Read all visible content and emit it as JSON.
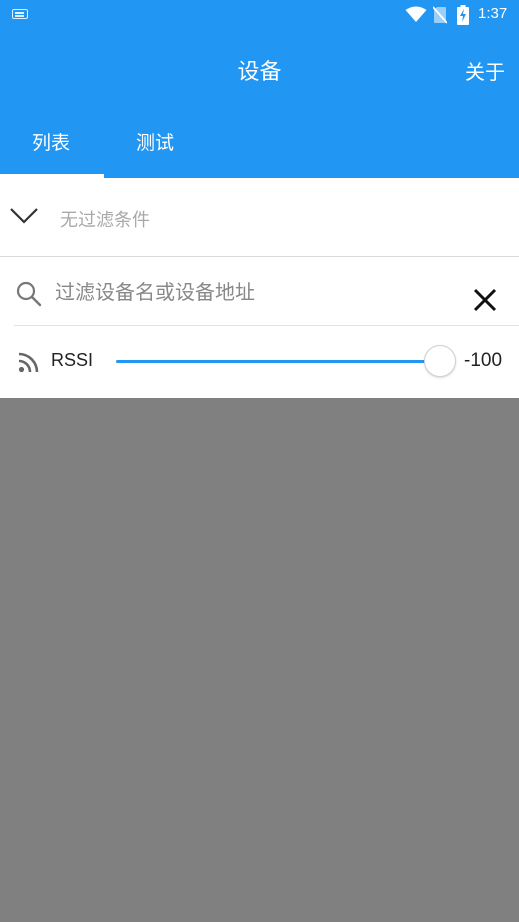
{
  "status_bar": {
    "time": "1:37"
  },
  "app_bar": {
    "title": "设备",
    "about_label": "关于"
  },
  "tabs": [
    {
      "label": "列表",
      "selected": true
    },
    {
      "label": "测试",
      "selected": false
    }
  ],
  "filter": {
    "summary_label": "无过滤条件",
    "search": {
      "placeholder": "过滤设备名或设备地址",
      "value": ""
    },
    "rssi": {
      "label": "RSSI",
      "value": "-100",
      "slider_fraction": 1.0
    }
  },
  "colors": {
    "primary": "#2196F3",
    "background": "#808080",
    "panel": "#FFFFFF"
  },
  "icons": [
    "keyboard-icon",
    "wifi-icon",
    "no-sim-icon",
    "battery-charging-icon",
    "chevron-down-icon",
    "search-icon",
    "close-icon",
    "rss-signal-icon"
  ]
}
